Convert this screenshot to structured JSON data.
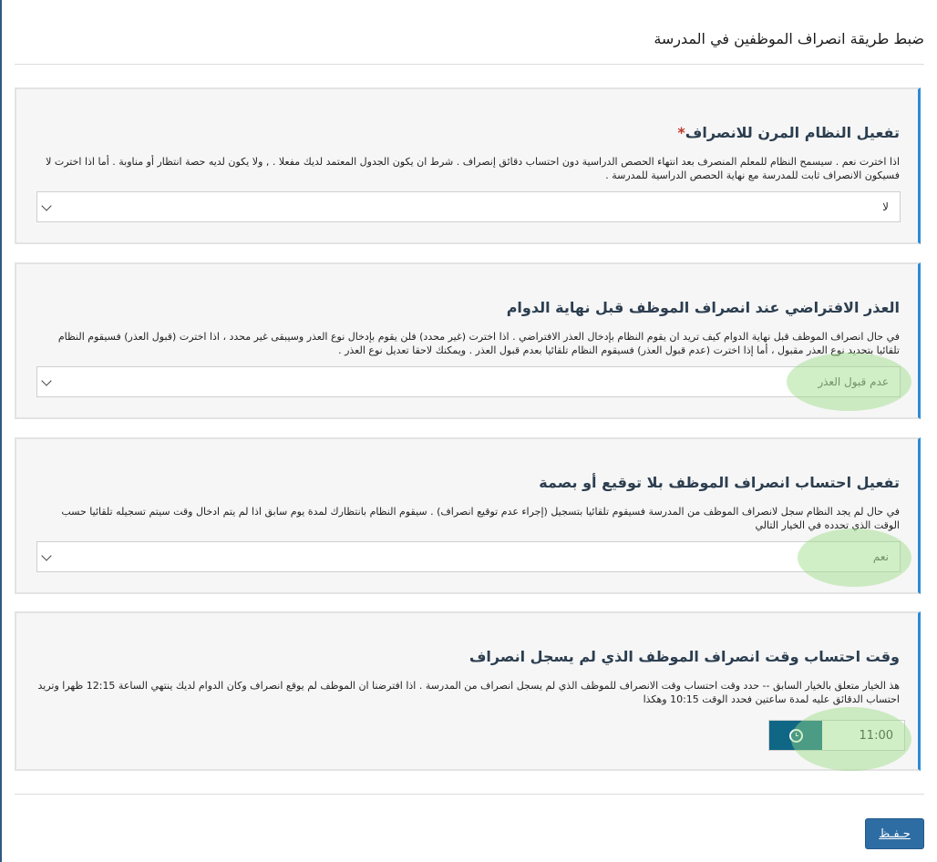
{
  "page": {
    "title": "ضبط طريقة انصراف الموظفين في المدرسة"
  },
  "sections": [
    {
      "title": "تفعيل النظام المرن للانصراف",
      "required_marker": "*",
      "description": "اذا اخترت نعم . سيسمح النظام للمعلم المنصرف بعد انتهاء الحصص الدراسية دون احتساب دقائق إنصراف . شرط ان يكون الجدول المعتمد لديك مفعلا . , ولا يكون لديه حصة انتظار أو مناوبة . أما اذا اخترت لا فسيكون الانصراف ثابت للمدرسة مع نهاية الحصص الدراسية للمدرسة .",
      "value": "لا"
    },
    {
      "title": "العذر الافتراضي عند انصراف الموظف قبل نهاية الدوام",
      "description": "في حال انصراف الموظف قبل نهاية الدوام كيف تريد ان يقوم النظام بإدخال العذر الافتراضي . اذا اخترت (غير محدد) فلن يقوم بإدخال نوع العذر وسيبقى غير محدد ، اذا اخترت (قبول العذر) فسيقوم النظام تلقائيا بتحديد نوع العذر مقبول ، أما إذا اخترت (عدم قبول العذر) فسيقوم النظام تلقائيا بعدم قبول العذر . ويمكنك لاحقا تعديل نوع العذر .",
      "value": "عدم قبول العذر"
    },
    {
      "title": "تفعيل احتساب انصراف الموظف بلا توقيع أو بصمة",
      "description": "في حال لم يجد النظام سجل لانصراف الموظف من المدرسة فسيقوم تلقائيا بتسجيل (إجراء عدم توقيع انصراف) . سيقوم النظام بانتظارك لمدة يوم سابق اذا لم يتم ادخال وقت سيتم تسجيله تلقائيا حسب الوقت الذي تحدده في الخيار التالي",
      "value": "نعم"
    },
    {
      "title": "وقت احتساب وقت انصراف الموظف الذي لم يسجل انصراف",
      "description": "هذ الخيار متعلق بالخيار السابق -- حدد وقت احتساب وقت الانصراف للموظف الذي لم يسجل انصراف من المدرسة . اذا افترضنا ان الموظف لم يوقع انصراف وكان الدوام لديك ينتهي الساعة 12:15 ظهرا وتريد احتساب الدقائق عليه لمدة ساعتين فحدد الوقت 10:15 وهكذا",
      "value": "11:00",
      "time_icon": "clock-icon"
    }
  ],
  "save_label": "حـفـظ",
  "colors": {
    "accent": "#2c8bd6",
    "save_button": "#2e6da4",
    "time_button": "#0f6785",
    "highlight": "#96dc82"
  }
}
